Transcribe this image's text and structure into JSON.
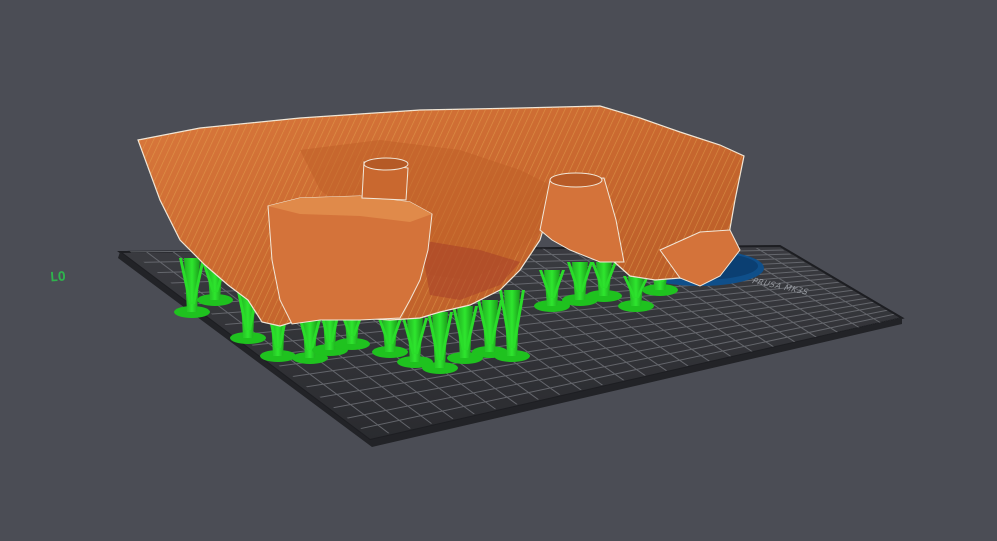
{
  "viewport": {
    "background": "#4b4d55",
    "bed_color": "#2c2d32",
    "grid_color": "#6a6c72",
    "model_color": "#d4733a",
    "model_highlight": "#e0a24a",
    "support_color": "#1ed51e",
    "selection_disk_color": "#0f4f8a",
    "origin_label": "LO",
    "bed_text": "PRUSA MK3S"
  }
}
